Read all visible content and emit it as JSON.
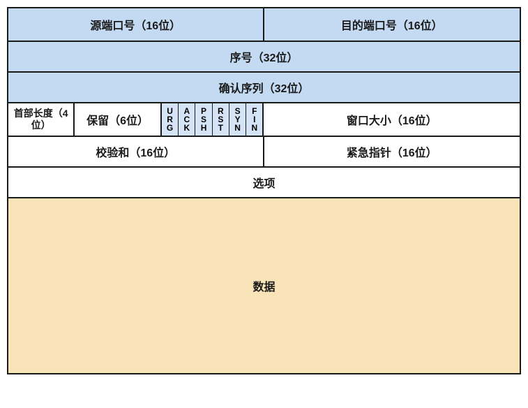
{
  "row1": {
    "source_port": "源端口号（16位）",
    "dest_port": "目的端口号（16位）"
  },
  "row2": {
    "sequence": "序号（32位）"
  },
  "row3": {
    "ack_sequence": "确认序列（32位）"
  },
  "row4": {
    "header_length": "首部长度（4位）",
    "reserved": "保留（6位）",
    "flags": {
      "urg": [
        "U",
        "R",
        "G"
      ],
      "ack": [
        "A",
        "C",
        "K"
      ],
      "psh": [
        "P",
        "S",
        "H"
      ],
      "rst": [
        "R",
        "S",
        "T"
      ],
      "syn": [
        "S",
        "Y",
        "N"
      ],
      "fin": [
        "F",
        "I",
        "N"
      ]
    },
    "window": "窗口大小（16位）"
  },
  "row5": {
    "checksum": "校验和（16位）",
    "urgent_pointer": "紧急指针（16位）"
  },
  "row6": {
    "options": "选项"
  },
  "row7": {
    "data": "数据"
  }
}
